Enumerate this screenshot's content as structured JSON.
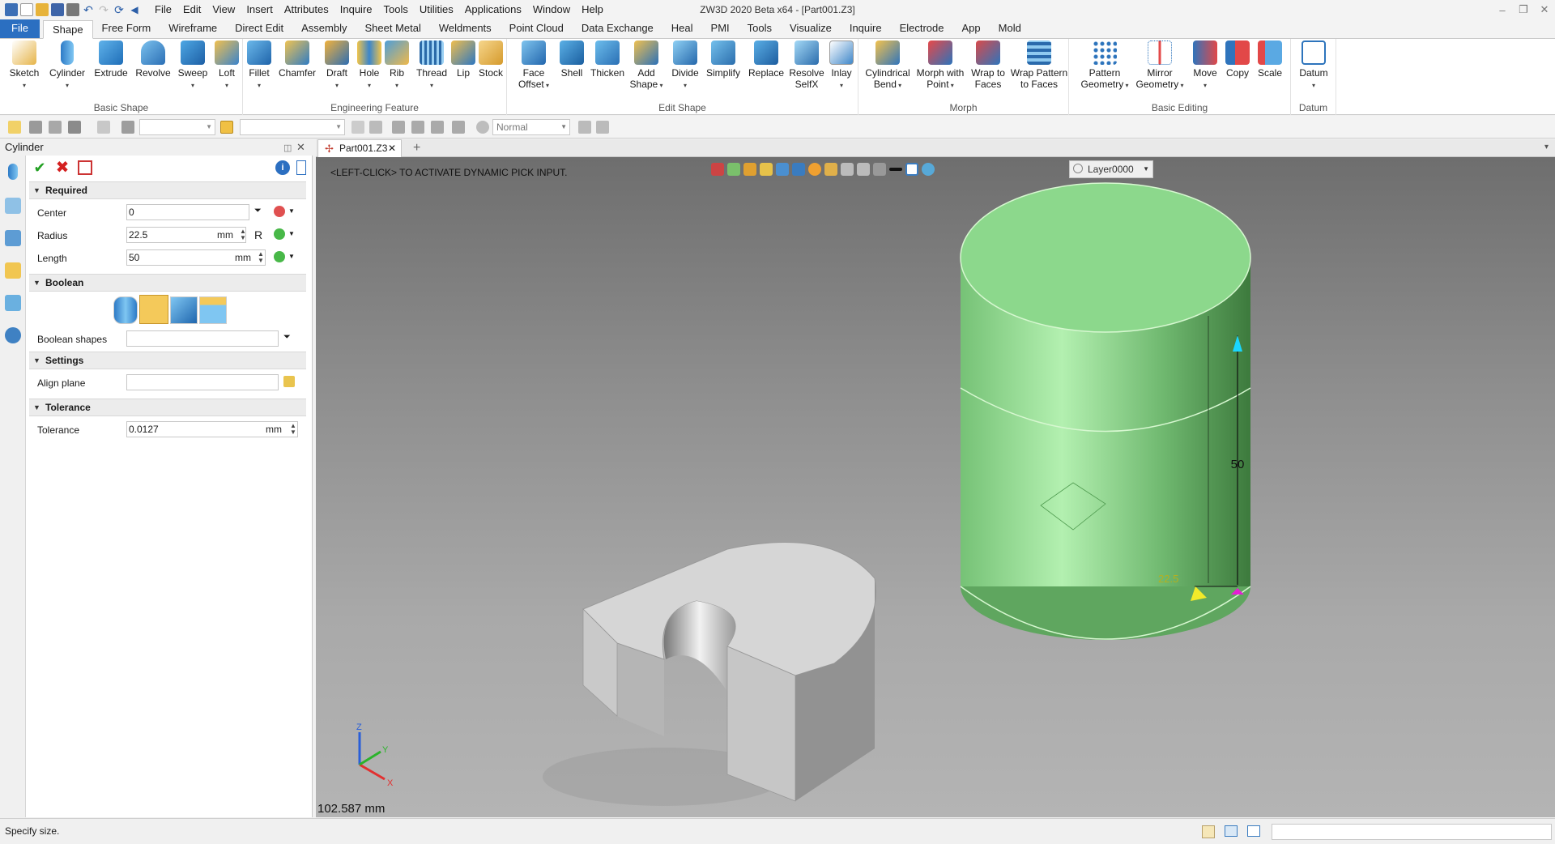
{
  "app_title": "ZW3D 2020 Beta x64 - [Part001.Z3]",
  "menu": [
    "File",
    "Edit",
    "View",
    "Insert",
    "Attributes",
    "Inquire",
    "Tools",
    "Utilities",
    "Applications",
    "Window",
    "Help"
  ],
  "ribbon_tabs": [
    "File",
    "Shape",
    "Free Form",
    "Wireframe",
    "Direct Edit",
    "Assembly",
    "Sheet Metal",
    "Weldments",
    "Point Cloud",
    "Data Exchange",
    "Heal",
    "PMI",
    "Tools",
    "Visualize",
    "Inquire",
    "Electrode",
    "App",
    "Mold"
  ],
  "active_tab": "Shape",
  "ribbon_groups": {
    "basic_shape": {
      "label": "Basic Shape",
      "tools": [
        "Sketch",
        "Cylinder",
        "Extrude",
        "Revolve",
        "Sweep",
        "Loft"
      ]
    },
    "engineering_feature": {
      "label": "Engineering Feature",
      "tools": [
        "Fillet",
        "Chamfer",
        "Draft",
        "Hole",
        "Rib",
        "Thread",
        "Lip",
        "Stock"
      ]
    },
    "edit_shape": {
      "label": "Edit Shape",
      "tools": [
        "Face\nOffset",
        "Shell",
        "Thicken",
        "Add\nShape",
        "Divide",
        "Simplify",
        "Replace",
        "Resolve\nSelfX",
        "Inlay"
      ]
    },
    "morph": {
      "label": "Morph",
      "tools": [
        "Cylindrical\nBend",
        "Morph with\nPoint",
        "Wrap to\nFaces",
        "Wrap Pattern\nto Faces"
      ]
    },
    "basic_editing": {
      "label": "Basic Editing",
      "tools": [
        "Pattern\nGeometry",
        "Mirror\nGeometry",
        "Move",
        "Copy",
        "Scale"
      ]
    },
    "datum": {
      "label": "Datum",
      "tools": [
        "Datum"
      ]
    }
  },
  "toolbar2": {
    "render_mode": "Normal"
  },
  "panel": {
    "title": "Cylinder",
    "required": {
      "label": "Required",
      "center_label": "Center",
      "center_value": "0",
      "radius_label": "Radius",
      "radius_value": "22.5",
      "radius_unit": "mm",
      "radius_suffix": "R",
      "length_label": "Length",
      "length_value": "50",
      "length_unit": "mm"
    },
    "boolean": {
      "label": "Boolean",
      "shapes_label": "Boolean shapes",
      "shapes_value": ""
    },
    "settings": {
      "label": "Settings",
      "align_label": "Align plane",
      "align_value": ""
    },
    "tolerance": {
      "label": "Tolerance",
      "tol_label": "Tolerance",
      "tol_value": "0.0127",
      "tol_unit": "mm"
    }
  },
  "doc_tab": "Part001.Z3",
  "viewport": {
    "hint": "<LEFT-CLICK> TO ACTIVATE DYNAMIC PICK INPUT.",
    "layer": "Layer0000",
    "measure": "102.587 mm",
    "dim_length": "50",
    "dim_radius": "22.5",
    "axis_labels": {
      "x": "X",
      "y": "Y",
      "z": "Z"
    }
  },
  "status": "Specify size.",
  "colors": {
    "accent": "#2b6fc1",
    "cylinder": "#8fd88f",
    "part": "#d4d4d4"
  }
}
